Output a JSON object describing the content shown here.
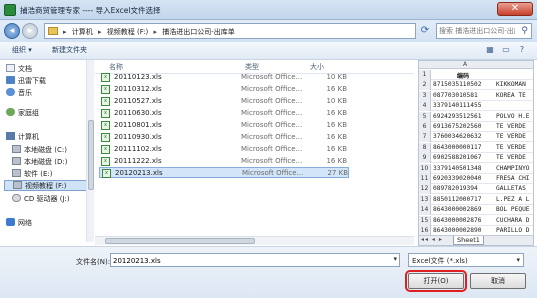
{
  "window": {
    "title": "捕浩商贸管理专家 ---- 导入Excel文件选择",
    "close_glyph": "✕"
  },
  "address": {
    "crumbs": [
      "计算机",
      "视频教程 (F:)",
      "捕浩进出口公司-出库单"
    ],
    "separator": "▸",
    "search_placeholder": "搜索 捕浩进出口公司-出库单",
    "refresh_glyph": "⟳",
    "search_glyph": "⚲"
  },
  "toolbar": {
    "organize_label": "组织 ▾",
    "new_folder_label": "新建文件夹",
    "view_glyph": "▦",
    "preview_glyph": "▭",
    "help_glyph": "?"
  },
  "nav": {
    "items": [
      {
        "label": "文档",
        "icon": "document-icon"
      },
      {
        "label": "迅雷下载",
        "icon": "download-icon"
      },
      {
        "label": "音乐",
        "icon": "music-icon"
      },
      {
        "label": "家庭组",
        "icon": "homegroup-icon"
      },
      {
        "label": "计算机",
        "icon": "computer-icon"
      },
      {
        "label": "本地磁盘 (C:)",
        "icon": "drive-icon"
      },
      {
        "label": "本地磁盘 (D:)",
        "icon": "drive-icon"
      },
      {
        "label": "软件 (E:)",
        "icon": "drive-icon"
      },
      {
        "label": "视频教程 (F:)",
        "icon": "drive-icon",
        "selected": true
      },
      {
        "label": "CD 驱动器 (J:)",
        "icon": "dvd-icon"
      },
      {
        "label": "网络",
        "icon": "network-icon"
      }
    ]
  },
  "files": {
    "headers": {
      "name": "名称",
      "type": "类型",
      "size": "大小"
    },
    "rows": [
      {
        "name": "20110123.xls",
        "type": "Microsoft Office...",
        "size": "10 KB"
      },
      {
        "name": "20110312.xls",
        "type": "Microsoft Office...",
        "size": "16 KB"
      },
      {
        "name": "20110527.xls",
        "type": "Microsoft Office...",
        "size": "10 KB"
      },
      {
        "name": "20110630.xls",
        "type": "Microsoft Office...",
        "size": "16 KB"
      },
      {
        "name": "20110801.xls",
        "type": "Microsoft Office...",
        "size": "16 KB"
      },
      {
        "name": "20110930.xls",
        "type": "Microsoft Office...",
        "size": "16 KB"
      },
      {
        "name": "20111102.xls",
        "type": "Microsoft Office...",
        "size": "16 KB"
      },
      {
        "name": "20111222.xls",
        "type": "Microsoft Office...",
        "size": "16 KB"
      },
      {
        "name": "20120213.xls",
        "type": "Microsoft Office...",
        "size": "27 KB",
        "selected": true
      }
    ]
  },
  "preview": {
    "col_header": "A",
    "header_cell": "编码",
    "rows": [
      {
        "n": "1",
        "code": "",
        "desc": ""
      },
      {
        "n": "2",
        "code": "8715035110502",
        "desc": "KIKKOMAN"
      },
      {
        "n": "3",
        "code": "087703010581",
        "desc": "KOREA TE"
      },
      {
        "n": "4",
        "code": "3379140111455",
        "desc": ""
      },
      {
        "n": "5",
        "code": "6924293512561",
        "desc": "POLVO H.E"
      },
      {
        "n": "6",
        "code": "6913675202560",
        "desc": "TE VERDE"
      },
      {
        "n": "7",
        "code": "3760034620632",
        "desc": "TE VERDE"
      },
      {
        "n": "8",
        "code": "8643000000117",
        "desc": "TE VERDE"
      },
      {
        "n": "9",
        "code": "6902588201067",
        "desc": "TE VERDE"
      },
      {
        "n": "10",
        "code": "3379140501348",
        "desc": "CHAMPINYO"
      },
      {
        "n": "11",
        "code": "6920339020040",
        "desc": "FRESA CHI"
      },
      {
        "n": "12",
        "code": "089782019394",
        "desc": "GALLETAS"
      },
      {
        "n": "13",
        "code": "8850112000717",
        "desc": "L.PEZ A L"
      },
      {
        "n": "14",
        "code": "8643000002869",
        "desc": "BOL PEQUE"
      },
      {
        "n": "15",
        "code": "8643000002876",
        "desc": "CUCHARA D"
      },
      {
        "n": "16",
        "code": "8643000002890",
        "desc": "PARILLO D"
      }
    ],
    "sheet_tab": "Sheet1",
    "tab_nav": "◂◂ ◂ ▸"
  },
  "footer": {
    "filename_label": "文件名(N):",
    "filename_value": "20120213.xls",
    "filter_value": "Excel文件 (*.xls)",
    "dropdown_glyph": "▾",
    "open_label": "打开(O)",
    "cancel_label": "取消"
  }
}
